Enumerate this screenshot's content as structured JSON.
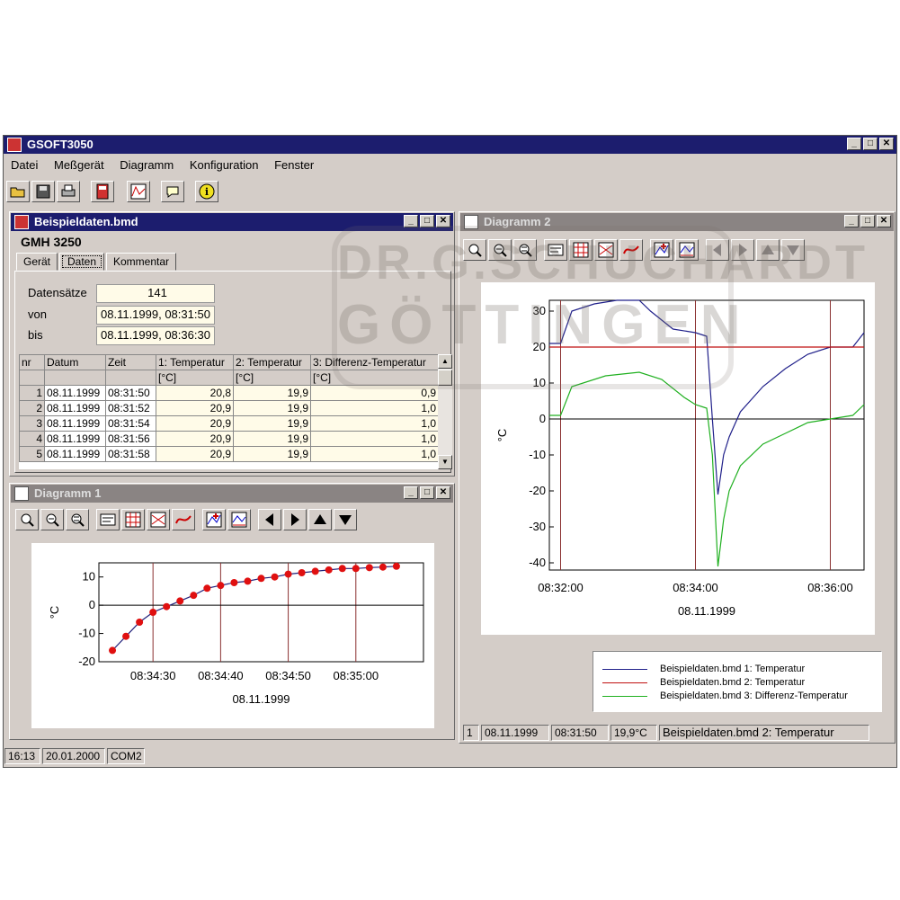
{
  "app": {
    "title": "GSOFT3050",
    "menu": [
      "Datei",
      "Meßgerät",
      "Diagramm",
      "Konfiguration",
      "Fenster"
    ],
    "toolbar_icons": [
      "open-folder-icon",
      "save-disk-icon",
      "printer-icon",
      "device-icon",
      "diagram-icon",
      "comment-icon",
      "info-icon"
    ],
    "status": {
      "time": "16:13",
      "date": "20.01.2000",
      "port": "COM2"
    },
    "watermark": [
      "DR.G.SCHUCHARDT",
      "GÖTTINGEN"
    ]
  },
  "data_window": {
    "title": "Beispieldaten.bmd",
    "device": "GMH 3250",
    "tabs": [
      "Gerät",
      "Daten",
      "Kommentar"
    ],
    "active_tab": "Daten",
    "fields": [
      {
        "label": "Datensätze",
        "value": "141"
      },
      {
        "label": "von",
        "value": "08.11.1999, 08:31:50"
      },
      {
        "label": "bis",
        "value": "08.11.1999, 08:36:30"
      }
    ],
    "table": {
      "headers": [
        "nr",
        "Datum",
        "Zeit",
        "1: Temperatur",
        "2: Temperatur",
        "3: Differenz-Temperatur"
      ],
      "units": [
        "",
        "",
        "",
        "[°C]",
        "[°C]",
        "[°C]"
      ],
      "rows": [
        [
          "1",
          "08.11.1999",
          "08:31:50",
          "20,8",
          "19,9",
          "0,9"
        ],
        [
          "2",
          "08.11.1999",
          "08:31:52",
          "20,9",
          "19,9",
          "1,0"
        ],
        [
          "3",
          "08.11.1999",
          "08:31:54",
          "20,9",
          "19,9",
          "1,0"
        ],
        [
          "4",
          "08.11.1999",
          "08:31:56",
          "20,9",
          "19,9",
          "1,0"
        ],
        [
          "5",
          "08.11.1999",
          "08:31:58",
          "20,9",
          "19,9",
          "1,0"
        ]
      ]
    }
  },
  "diagram1": {
    "title": "Diagramm 1",
    "ylabel": "°C",
    "xlabel": "08.11.1999",
    "line_color": "#20207a",
    "marker_color": "#e01010"
  },
  "diagram2": {
    "title": "Diagramm 2",
    "ylabel": "°C",
    "xlabel": "08.11.1999",
    "legend": [
      {
        "name": "Beispieldaten.bmd 1: Temperatur",
        "color": "#20208a"
      },
      {
        "name": "Beispieldaten.bmd 2: Temperatur",
        "color": "#c01010"
      },
      {
        "name": "Beispieldaten.bmd 3: Differenz-Temperatur",
        "color": "#20b020"
      }
    ],
    "status": [
      "1",
      "08.11.1999",
      "08:31:50",
      "19,9°C",
      "Beispieldaten.bmd 2: Temperatur"
    ]
  },
  "chart_data": [
    {
      "type": "scatter",
      "title": "",
      "xlabel": "08.11.1999",
      "ylabel": "°C",
      "xlim": [
        "08:34:22",
        "08:35:10"
      ],
      "ylim": [
        -20,
        15
      ],
      "x_ticks": [
        "08:34:30",
        "08:34:40",
        "08:34:50",
        "08:35:00"
      ],
      "y_ticks": [
        -20,
        -10,
        0,
        10
      ],
      "series": [
        {
          "x": [
            "08:34:24",
            "08:34:26",
            "08:34:28",
            "08:34:30",
            "08:34:32",
            "08:34:34",
            "08:34:36",
            "08:34:38",
            "08:34:40",
            "08:34:42",
            "08:34:44",
            "08:34:46",
            "08:34:48",
            "08:34:50",
            "08:34:52",
            "08:34:54",
            "08:34:56",
            "08:34:58",
            "08:35:00",
            "08:35:02",
            "08:35:04",
            "08:35:06"
          ],
          "y": [
            -16,
            -11,
            -6,
            -2.5,
            -0.5,
            1.5,
            3.5,
            6,
            7,
            8,
            8.5,
            9.5,
            10,
            11,
            11.5,
            12,
            12.5,
            13,
            13,
            13.3,
            13.5,
            13.8
          ]
        }
      ]
    },
    {
      "type": "line",
      "title": "",
      "xlabel": "08.11.1999",
      "ylabel": "°C",
      "xlim": [
        "08:31:50",
        "08:36:30"
      ],
      "ylim": [
        -42,
        33
      ],
      "x_ticks": [
        "08:32:00",
        "08:34:00",
        "08:36:00"
      ],
      "y_ticks": [
        -40,
        -30,
        -20,
        -10,
        0,
        10,
        20,
        30
      ],
      "series": [
        {
          "name": "Beispieldaten.bmd 1: Temperatur",
          "x": [
            "08:31:50",
            "08:32:00",
            "08:32:10",
            "08:32:30",
            "08:32:50",
            "08:33:10",
            "08:33:20",
            "08:33:40",
            "08:34:00",
            "08:34:10",
            "08:34:15",
            "08:34:20",
            "08:34:25",
            "08:34:30",
            "08:34:40",
            "08:35:00",
            "08:35:20",
            "08:35:40",
            "08:36:00",
            "08:36:20",
            "08:36:30"
          ],
          "y": [
            21,
            21,
            30,
            32,
            33,
            33,
            30,
            25,
            24,
            23,
            0,
            -21,
            -10,
            -5,
            2,
            9,
            14,
            18,
            20,
            20,
            24
          ]
        },
        {
          "name": "Beispieldaten.bmd 2: Temperatur",
          "x": [
            "08:31:50",
            "08:36:30"
          ],
          "y": [
            20,
            20
          ]
        },
        {
          "name": "Beispieldaten.bmd 3: Differenz-Temperatur",
          "x": [
            "08:31:50",
            "08:32:00",
            "08:32:10",
            "08:32:40",
            "08:33:10",
            "08:33:30",
            "08:33:50",
            "08:34:00",
            "08:34:10",
            "08:34:15",
            "08:34:20",
            "08:34:25",
            "08:34:30",
            "08:34:40",
            "08:35:00",
            "08:35:20",
            "08:35:40",
            "08:36:00",
            "08:36:20",
            "08:36:30"
          ],
          "y": [
            1,
            1,
            9,
            12,
            13,
            11,
            6,
            4,
            3,
            -10,
            -41,
            -28,
            -20,
            -13,
            -7,
            -4,
            -1,
            0,
            1,
            4
          ]
        }
      ]
    }
  ]
}
